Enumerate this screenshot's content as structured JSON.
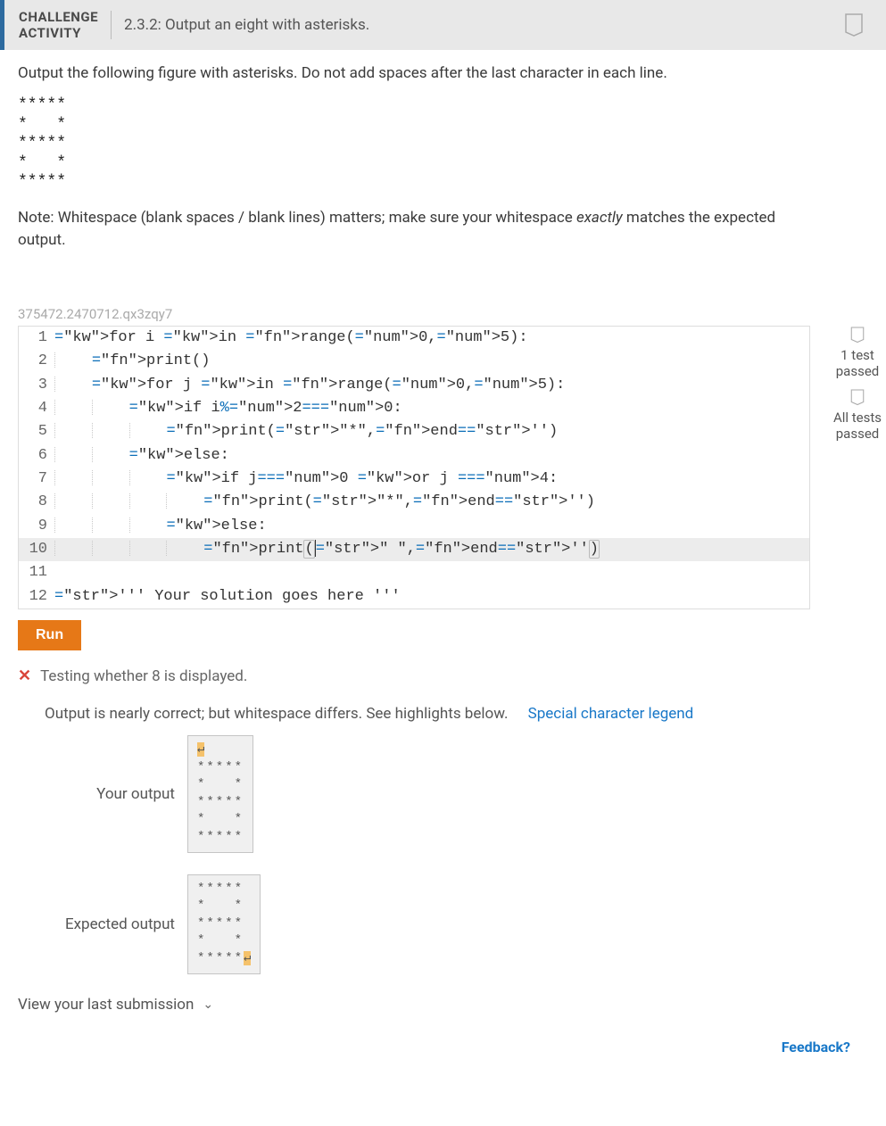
{
  "header": {
    "label_line1": "CHALLENGE",
    "label_line2": "ACTIVITY",
    "title": "2.3.2: Output an eight with asterisks."
  },
  "instructions": "Output the following figure with asterisks. Do not add spaces after the last character in each line.",
  "figure_lines": [
    "*****",
    "*   *",
    "*****",
    "*   *",
    "*****"
  ],
  "note_prefix": "Note: Whitespace (blank spaces / blank lines) matters; make sure your whitespace ",
  "note_em": "exactly",
  "note_suffix": " matches the expected output.",
  "hash": "375472.2470712.qx3zqy7",
  "side_badges": {
    "b1": "1 test passed",
    "b2": "All tests passed"
  },
  "code_lines": [
    {
      "n": 1,
      "raw": "for i in range(0,5):"
    },
    {
      "n": 2,
      "raw": "    print()"
    },
    {
      "n": 3,
      "raw": "    for j in range(0,5):"
    },
    {
      "n": 4,
      "raw": "        if i%2==0:"
    },
    {
      "n": 5,
      "raw": "            print(\"*\",end='')"
    },
    {
      "n": 6,
      "raw": "        else:"
    },
    {
      "n": 7,
      "raw": "            if j==0 or j ==4:"
    },
    {
      "n": 8,
      "raw": "                print(\"*\",end='')"
    },
    {
      "n": 9,
      "raw": "            else:"
    },
    {
      "n": 10,
      "raw": "                print(\" \",end='')"
    },
    {
      "n": 11,
      "raw": ""
    },
    {
      "n": 12,
      "raw": "''' Your solution goes here '''"
    }
  ],
  "run_label": "Run",
  "test_result": {
    "icon": "✕",
    "msg": "Testing whether 8 is displayed."
  },
  "diff_msg": "Output is nearly correct; but whitespace differs. See highlights below.",
  "legend_label": "Special character legend",
  "your_output_label": "Your output",
  "expected_output_label": "Expected output",
  "your_output": {
    "pre_hl": "↵",
    "body": "\n*****\n*   *\n*****\n*   *\n*****"
  },
  "expected_output": {
    "body": "*****\n*   *\n*****\n*   *\n*****",
    "post_hl": "↵"
  },
  "last_submission": "View your last submission",
  "feedback": "Feedback?"
}
